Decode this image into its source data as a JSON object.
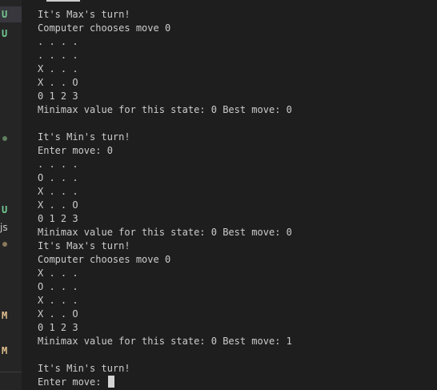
{
  "sidebar": {
    "marks": [
      {
        "label": "U",
        "color": "#73c991"
      },
      {
        "label": "U",
        "color": "#73c991"
      },
      {
        "label": "U",
        "color": "#73c991"
      },
      {
        "label": "M",
        "color": "#e2c08d"
      },
      {
        "label": "M",
        "color": "#e2c08d"
      }
    ],
    "js_label": "js"
  },
  "terminal": {
    "lines": [
      "It's Max's turn!",
      "Computer chooses move 0",
      ". . . .",
      ". . . .",
      "X . . .",
      "X . . O",
      "0 1 2 3",
      "Minimax value for this state: 0 Best move: 0",
      "",
      "It's Min's turn!",
      "Enter move: 0",
      ". . . .",
      "O . . .",
      "X . . .",
      "X . . O",
      "0 1 2 3",
      "Minimax value for this state: 0 Best move: 0",
      "It's Max's turn!",
      "Computer chooses move 0",
      "X . . .",
      "O . . .",
      "X . . .",
      "X . . O",
      "0 1 2 3",
      "Minimax value for this state: 0 Best move: 1",
      "",
      "It's Min's turn!"
    ],
    "prompt": "Enter move: "
  }
}
